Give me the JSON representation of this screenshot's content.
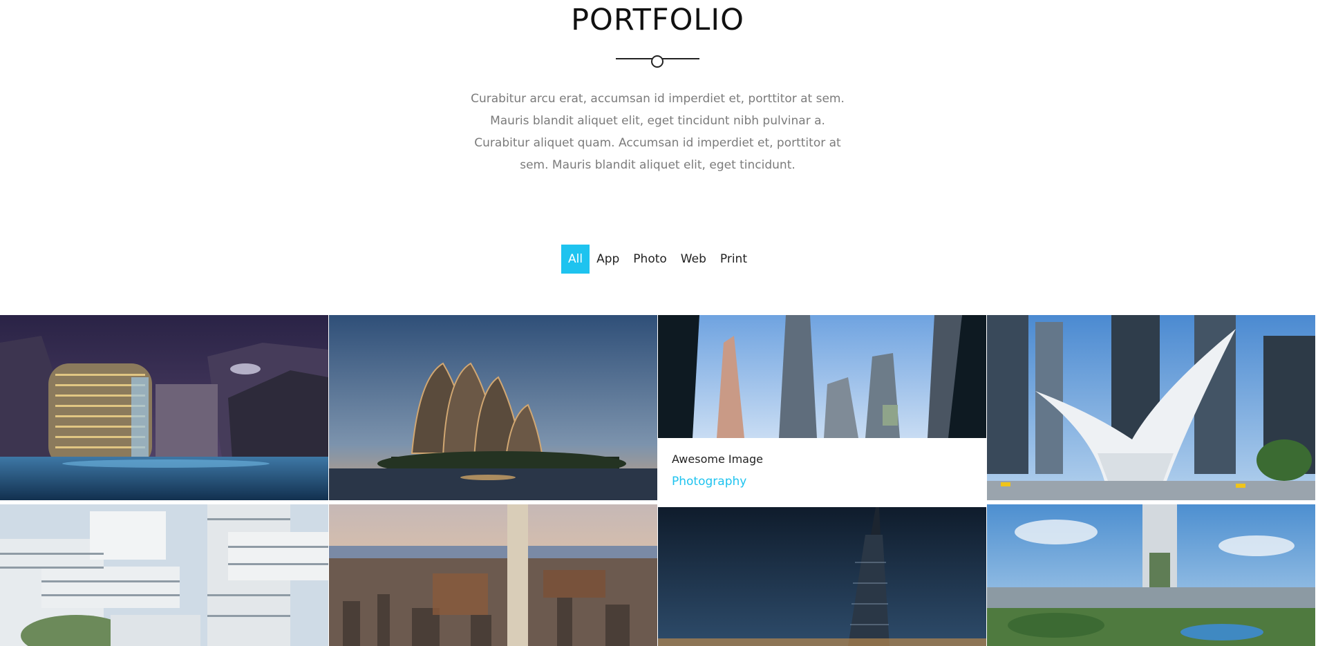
{
  "section": {
    "title": "PORTFOLIO",
    "intro": "Curabitur arcu erat, accumsan id imperdiet et, porttitor at sem. Mauris blandit aliquet elit, eget tincidunt nibh pulvinar a. Curabitur aliquet quam. Accumsan id imperdiet et, porttitor at sem. Mauris blandit aliquet elit, eget tincidunt."
  },
  "filters": [
    {
      "label": "All",
      "active": true
    },
    {
      "label": "App",
      "active": false
    },
    {
      "label": "Photo",
      "active": false
    },
    {
      "label": "Web",
      "active": false
    },
    {
      "label": "Print",
      "active": false
    }
  ],
  "hover_caption": {
    "title": "Awesome Image",
    "category": "Photography"
  },
  "colors": {
    "accent": "#1ec3ef",
    "heading": "#111111",
    "body_text": "#7b7b7b"
  },
  "scrollbar": {
    "up_icon": "arrow-up-icon",
    "down_icon": "arrow-down-icon"
  }
}
